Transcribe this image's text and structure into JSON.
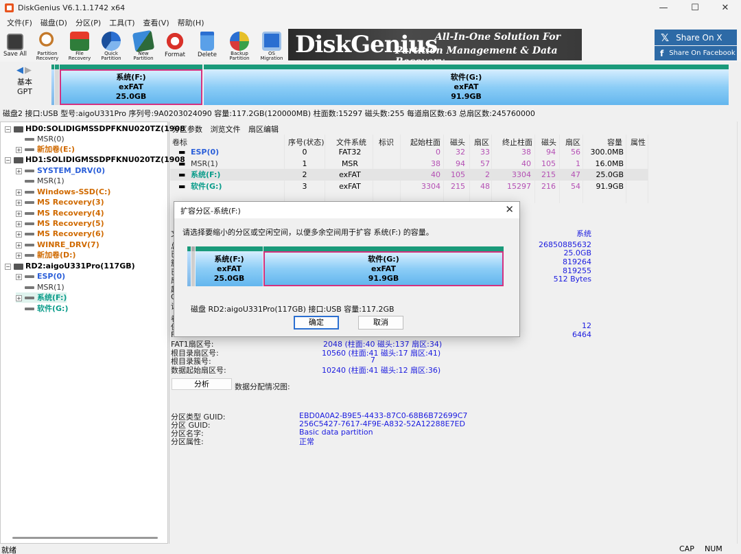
{
  "window": {
    "title": "DiskGenius V6.1.1.1742 x64",
    "minimize": "—",
    "maximize": "☐",
    "close": "✕"
  },
  "menu": [
    "文件(F)",
    "磁盘(D)",
    "分区(P)",
    "工具(T)",
    "查看(V)",
    "帮助(H)"
  ],
  "toolbar": [
    {
      "label": "Save All",
      "icon": "save-all-icon"
    },
    {
      "label": "Partition\nRecovery",
      "icon": "partition-recovery-icon"
    },
    {
      "label": "File\nRecovery",
      "icon": "file-recovery-icon"
    },
    {
      "label": "Quick\nPartition",
      "icon": "quick-partition-icon"
    },
    {
      "label": "New\nPartition",
      "icon": "new-partition-icon"
    },
    {
      "label": "Format",
      "icon": "format-icon"
    },
    {
      "label": "Delete",
      "icon": "delete-icon"
    },
    {
      "label": "Backup\nPartition",
      "icon": "backup-partition-icon"
    },
    {
      "label": "OS Migration",
      "icon": "os-migration-icon"
    }
  ],
  "banner": {
    "logo": "DiskGenius",
    "line1": "All-In-One Solution For",
    "line2": "Partition Management & Data Recovery"
  },
  "share": {
    "x": "Share On X",
    "facebook": "Share On Facebook"
  },
  "diskmap": {
    "label1": "基本",
    "label2": "GPT",
    "partitions": [
      {
        "name": "系统(F:)",
        "fs": "exFAT",
        "size": "25.0GB"
      },
      {
        "name": "软件(G:)",
        "fs": "exFAT",
        "size": "91.9GB"
      }
    ]
  },
  "disk_info": "磁盘2 接口:USB  型号:aigoU331Pro  序列号:9A0203024090  容量:117.2GB(120000MB)  柱面数:15297  磁头数:255  每道扇区数:63  总扇区数:245760000",
  "tree": [
    {
      "label": "HD0:SOLIDIGMSSDPFKNU020TZ(1908",
      "level": 0,
      "style": "c-dark",
      "kind": "disk"
    },
    {
      "label": "MSR(0)",
      "level": 1,
      "style": "c-gray",
      "kind": "part"
    },
    {
      "label": "新加卷(E:)",
      "level": 1,
      "style": "c-orange",
      "kind": "plus"
    },
    {
      "label": "HD1:SOLIDIGMSSDPFKNU020TZ(1908",
      "level": 0,
      "style": "c-dark",
      "kind": "disk"
    },
    {
      "label": "SYSTEM_DRV(0)",
      "level": 1,
      "style": "c-blue",
      "kind": "plus"
    },
    {
      "label": "MSR(1)",
      "level": 1,
      "style": "c-gray",
      "kind": "part"
    },
    {
      "label": "Windows-SSD(C:)",
      "level": 1,
      "style": "c-orange",
      "kind": "plus"
    },
    {
      "label": "MS Recovery(3)",
      "level": 1,
      "style": "c-orange",
      "kind": "plus"
    },
    {
      "label": "MS Recovery(4)",
      "level": 1,
      "style": "c-orange",
      "kind": "plus"
    },
    {
      "label": "MS Recovery(5)",
      "level": 1,
      "style": "c-orange",
      "kind": "plus"
    },
    {
      "label": "MS Recovery(6)",
      "level": 1,
      "style": "c-orange",
      "kind": "plus"
    },
    {
      "label": "WINRE_DRV(7)",
      "level": 1,
      "style": "c-orange",
      "kind": "plus"
    },
    {
      "label": "新加卷(D:)",
      "level": 1,
      "style": "c-orange",
      "kind": "plus"
    },
    {
      "label": "RD2:aigoU331Pro(117GB)",
      "level": 0,
      "style": "c-dark",
      "kind": "disk"
    },
    {
      "label": "ESP(0)",
      "level": 1,
      "style": "c-blue",
      "kind": "plus"
    },
    {
      "label": "MSR(1)",
      "level": 1,
      "style": "c-gray",
      "kind": "part"
    },
    {
      "label": "系统(F:)",
      "level": 1,
      "style": "c-teal",
      "kind": "plus"
    },
    {
      "label": "软件(G:)",
      "level": 1,
      "style": "c-teal",
      "kind": "part"
    }
  ],
  "right_tabs": [
    "分区参数",
    "浏览文件",
    "扇区编辑"
  ],
  "table": {
    "headers": [
      "卷标",
      "序号(状态)",
      "文件系统",
      "标识",
      "起始柱面",
      "磁头",
      "扇区",
      "终止柱面",
      "磁头",
      "扇区",
      "容量",
      "属性"
    ],
    "rows": [
      {
        "label": "ESP(0)",
        "num": "0",
        "fs": "FAT32",
        "id": "",
        "sc": "0",
        "sh": "32",
        "ss": "33",
        "ec": "38",
        "eh": "94",
        "es": "56",
        "cap": "300.0MB",
        "attr": ""
      },
      {
        "label": "MSR(1)",
        "num": "1",
        "fs": "MSR",
        "id": "",
        "sc": "38",
        "sh": "94",
        "ss": "57",
        "ec": "40",
        "eh": "105",
        "es": "1",
        "cap": "16.0MB",
        "attr": ""
      },
      {
        "label": "系统(F:)",
        "num": "2",
        "fs": "exFAT",
        "id": "",
        "sc": "40",
        "sh": "105",
        "ss": "2",
        "ec": "3304",
        "eh": "215",
        "es": "47",
        "cap": "25.0GB",
        "attr": ""
      },
      {
        "label": "软件(G:)",
        "num": "3",
        "fs": "exFAT",
        "id": "",
        "sc": "3304",
        "sh": "215",
        "ss": "48",
        "ec": "15297",
        "eh": "216",
        "es": "54",
        "cap": "91.9GB",
        "attr": ""
      }
    ]
  },
  "details": {
    "fs_label": "文",
    "fs_value": "系统",
    "v1": "26850885632",
    "v2": "25.0GB",
    "v3": "819264",
    "v4": "819255",
    "v5": "512 Bytes",
    "left_stubs": [
      "总",
      "已",
      "簇",
      "已",
      "扇",
      "起",
      "G",
      "设"
    ],
    "stub2": [
      "卷",
      "保",
      "F"
    ],
    "v6": "12",
    "v7": "6464",
    "fat1_label": "FAT1扇区号:",
    "fat1_value": "2048 (柱面:40 磁头:137 扇区:34)",
    "root_sector_label": "根目录扇区号:",
    "root_sector_value": "10560 (柱面:41 磁头:17 扇区:41)",
    "root_cluster_label": "根目录簇号:",
    "root_cluster_value": "7",
    "data_start_label": "数据起始扇区号:",
    "data_start_value": "10240 (柱面:41 磁头:12 扇区:36)",
    "analyze_btn": "分析",
    "alloc_label": "数据分配情况图:",
    "guid_type_label": "分区类型 GUID:",
    "guid_type_value": "EBD0A0A2-B9E5-4433-87C0-68B6B72699C7",
    "guid_label": "分区 GUID:",
    "guid_value": "256C5427-7617-4F9E-A832-52A12288E7ED",
    "name_label": "分区名字:",
    "name_value": "Basic data partition",
    "attr_label": "分区属性:",
    "attr_value": "正常"
  },
  "dialog": {
    "title": "扩容分区-系统(F:)",
    "close": "✕",
    "message": "请选择要缩小的分区或空闲空间，以便多余空间用于扩容 系统(F:) 的容量。",
    "partitions": [
      {
        "name": "系统(F:)",
        "fs": "exFAT",
        "size": "25.0GB"
      },
      {
        "name": "软件(G:)",
        "fs": "exFAT",
        "size": "91.9GB"
      }
    ],
    "disk_info": "磁盘 RD2:aigoU331Pro(117GB)  接口:USB  容量:117.2GB",
    "ok": "确定",
    "cancel": "取消"
  },
  "status": {
    "left": "就绪",
    "cap": "CAP",
    "num": "NUM"
  },
  "colors": {
    "accent_teal": "#0a9c8a",
    "selection": "#d4317f",
    "link_blue": "#1a1adf"
  }
}
